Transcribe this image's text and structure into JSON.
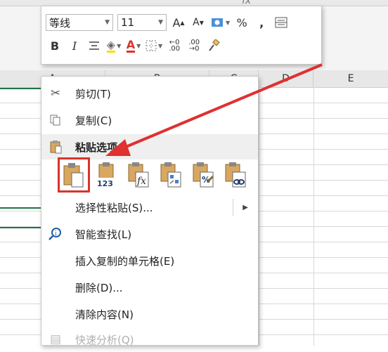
{
  "formula": {
    "fx_label": "fx"
  },
  "sheet": {
    "columns": [
      "A",
      "B",
      "C",
      "D",
      "E"
    ],
    "accent_color": "#217346"
  },
  "mini_toolbar": {
    "font_name": "等线",
    "font_size": "11",
    "grow_font": "A",
    "shrink_font": "A",
    "percent": "%",
    "comma": ",",
    "bold": "B",
    "italic": "I",
    "font_color_letter": "A",
    "inc_decimal": ".00",
    "dec_decimal": ".00",
    "font_color": "#d9342b",
    "fill_color": "#ffdd00"
  },
  "context_menu": {
    "items": [
      {
        "label": "剪切(T)",
        "icon": "scissors-icon"
      },
      {
        "label": "复制(C)",
        "icon": "copy-icon"
      },
      {
        "label": "粘贴选项:",
        "icon": "clipboard-icon"
      },
      {
        "label": "选择性粘贴(S)...",
        "icon": ""
      },
      {
        "label": "智能查找(L)",
        "icon": "smart-lookup-icon"
      },
      {
        "label": "插入复制的单元格(E)",
        "icon": ""
      },
      {
        "label": "删除(D)...",
        "icon": ""
      },
      {
        "label": "清除内容(N)",
        "icon": ""
      },
      {
        "label": "快速分析(Q)",
        "icon": "quick-analysis-icon"
      }
    ],
    "paste_options": [
      {
        "name": "paste",
        "sub": ""
      },
      {
        "name": "paste-values",
        "sub": "123"
      },
      {
        "name": "paste-formulas",
        "sub": "fx"
      },
      {
        "name": "paste-transpose",
        "sub": ""
      },
      {
        "name": "paste-formatting",
        "sub": "%"
      },
      {
        "name": "paste-link",
        "sub": ""
      }
    ],
    "selected_paste_option": "paste"
  },
  "annotation": {
    "arrow_color": "#e03030"
  }
}
